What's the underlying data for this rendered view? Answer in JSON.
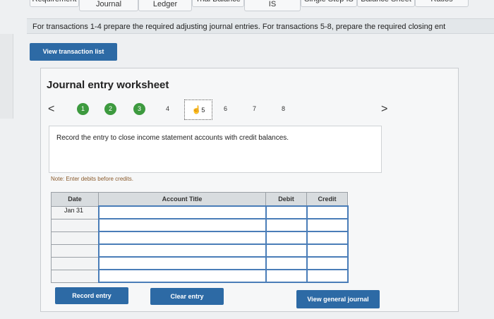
{
  "tabs": [
    {
      "label": "Requirement",
      "clipped": true
    },
    {
      "label": "Journal"
    },
    {
      "label": "Ledger"
    },
    {
      "label": "Trial Balance",
      "clipped": true
    },
    {
      "label": "IS"
    },
    {
      "label": "Single Step IS",
      "clipped": true
    },
    {
      "label": "Balance Sheet",
      "clipped": true
    },
    {
      "label": "Ratios",
      "clipped": true
    }
  ],
  "instruction": "For transactions 1-4 prepare the required adjusting journal entries. For transactions 5-8, prepare the required closing ent",
  "view_transaction_list": "View transaction list",
  "worksheet": {
    "title": "Journal entry worksheet",
    "steps": [
      {
        "label": "1",
        "state": "done"
      },
      {
        "label": "2",
        "state": "done"
      },
      {
        "label": "3",
        "state": "done"
      },
      {
        "label": "4",
        "state": "plain"
      },
      {
        "label": "5",
        "state": "current"
      },
      {
        "label": "6",
        "state": "plain"
      },
      {
        "label": "7",
        "state": "plain"
      },
      {
        "label": "8",
        "state": "plain"
      }
    ],
    "prev_arrow": "<",
    "next_arrow": ">",
    "description": "Record the entry to close income statement accounts with credit balances.",
    "note": "Note: Enter debits before credits."
  },
  "table": {
    "headers": {
      "date": "Date",
      "account": "Account Title",
      "debit": "Debit",
      "credit": "Credit"
    },
    "first_date": "Jan 31"
  },
  "buttons": {
    "record": "Record entry",
    "clear": "Clear entry",
    "view_general_journal": "View general journal"
  },
  "colors": {
    "button_blue": "#2d6aa5",
    "step_green": "#3d9a3f"
  }
}
